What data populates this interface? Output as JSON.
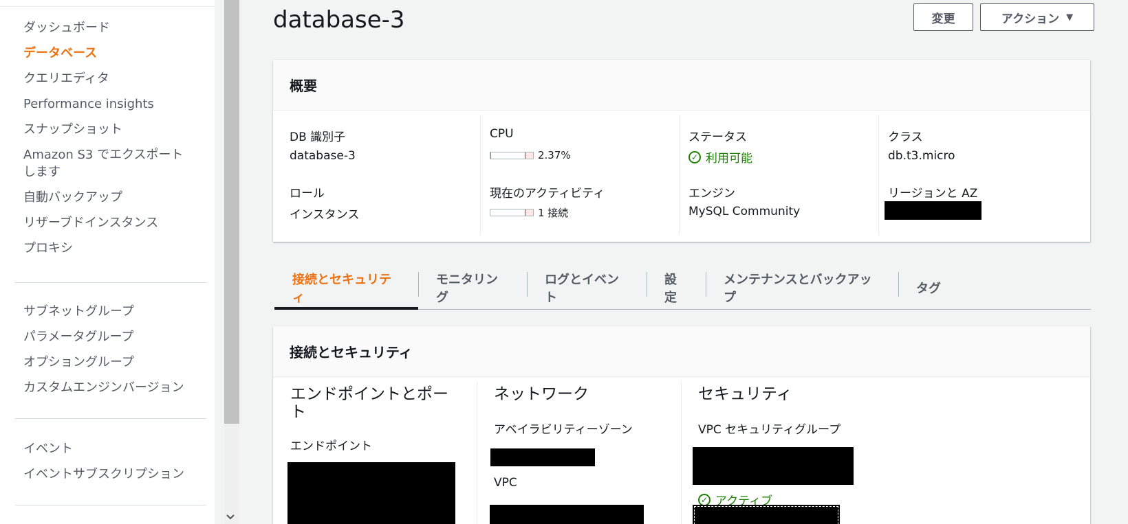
{
  "sidebar": {
    "group1": [
      "ダッシュボード",
      "データベース",
      "クエリエディタ",
      "Performance insights",
      "スナップショット",
      "Amazon S3 でエクスポートします",
      "自動バックアップ",
      "リザーブドインスタンス",
      "プロキシ"
    ],
    "group2": [
      "サブネットグループ",
      "パラメータグループ",
      "オプショングループ",
      "カスタムエンジンバージョン"
    ],
    "group3": [
      "イベント",
      "イベントサブスクリプション"
    ],
    "active": "データベース",
    "scroll_down_icon": "chevron-down-icon"
  },
  "header": {
    "title": "database-3",
    "edit_label": "変更",
    "actions_label": "アクション",
    "actions_caret": "▼"
  },
  "summary": {
    "title": "概要",
    "db_id_label": "DB 識別子",
    "db_id_value": "database-3",
    "role_label": "ロール",
    "role_value": "インスタンス",
    "cpu_label": "CPU",
    "cpu_value": "2.37%",
    "cpu_fraction": 0.0237,
    "activity_label": "現在のアクティビティ",
    "activity_value": "1 接続",
    "status_label": "ステータス",
    "status_value": "利用可能",
    "engine_label": "エンジン",
    "engine_value": "MySQL Community",
    "class_label": "クラス",
    "class_value": "db.t3.micro",
    "region_label": "リージョンと AZ"
  },
  "tabs": [
    "接続とセキュリティ",
    "モニタリング",
    "ログとイベント",
    "設定",
    "メンテナンスとバックアップ",
    "タグ"
  ],
  "conn_security": {
    "title": "接続とセキュリティ",
    "endpoint_port_title": "エンドポイントとポート",
    "endpoint_label": "エンドポイント",
    "network_title": "ネットワーク",
    "az_label": "アベイラビリティーゾーン",
    "vpc_label": "VPC",
    "security_title": "セキュリティ",
    "vpc_sg_label": "VPC セキュリティグループ",
    "sg_status": "アクティブ"
  },
  "colors": {
    "accent": "#ec7211",
    "success": "#1d8102",
    "redaction": "#000000"
  }
}
